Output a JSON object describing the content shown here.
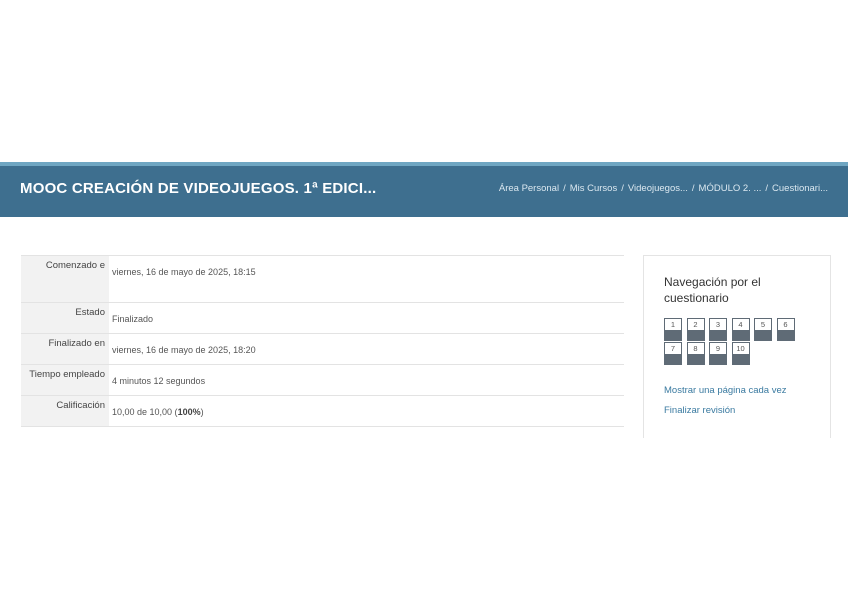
{
  "header": {
    "course_title": "MOOC CREACIÓN DE VIDEOJUEGOS. 1ª EDICI...",
    "breadcrumb": [
      "Área Personal",
      "Mis Cursos",
      "Videojuegos...",
      "MÓDULO 2. ...",
      "Cuestionari..."
    ]
  },
  "summary": {
    "rows": [
      {
        "label": "Comenzado e",
        "value": "viernes, 16 de mayo de 2025, 18:15"
      },
      {
        "label": "Estado",
        "value": "Finalizado"
      },
      {
        "label": "Finalizado en",
        "value": "viernes, 16 de mayo de 2025, 18:20"
      },
      {
        "label": "Tiempo empleado",
        "value": "4 minutos 12 segundos"
      },
      {
        "label": "Calificación",
        "value_prefix": "10,00 de 10,00 (",
        "value_bold": "100%",
        "value_suffix": ")"
      }
    ]
  },
  "quiz_nav": {
    "title": "Navegación por el cuestionario",
    "questions": [
      "1",
      "2",
      "3",
      "4",
      "5",
      "6",
      "7",
      "8",
      "9",
      "10"
    ],
    "show_one_page_link": "Mostrar una página cada vez",
    "finish_review_link": "Finalizar revisión"
  }
}
